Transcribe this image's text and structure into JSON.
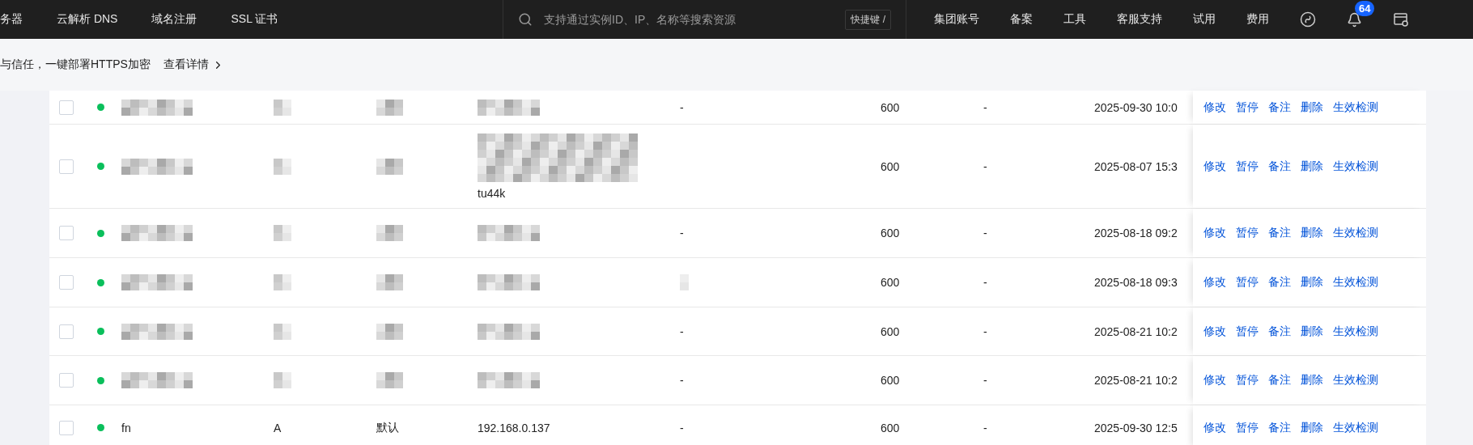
{
  "topbar": {
    "nav_left": [
      "务器",
      "云解析 DNS",
      "域名注册",
      "SSL 证书"
    ],
    "search": {
      "placeholder": "支持通过实例ID、IP、名称等搜索资源",
      "shortcut": "快捷键 /"
    },
    "nav_right": [
      "集团账号",
      "备案",
      "工具",
      "客服支持",
      "试用",
      "费用"
    ],
    "notifications": {
      "count": "64"
    }
  },
  "banner": {
    "text": "与信任，一键部署HTTPS加密",
    "link": "查看详情"
  },
  "records": [
    {
      "checked": false,
      "enabled": true,
      "host": {
        "kind": "redacted"
      },
      "type": {
        "kind": "redacted"
      },
      "line": {
        "kind": "redacted"
      },
      "value": {
        "kind": "redacted"
      },
      "remark": {
        "kind": "text",
        "text": "-"
      },
      "ttl": "600",
      "weight": "-",
      "time": "2025-09-30 10:0",
      "actions": [
        "修改",
        "暂停",
        "备注",
        "删除",
        "生效检测"
      ]
    },
    {
      "checked": false,
      "enabled": true,
      "host": {
        "kind": "redacted"
      },
      "type": {
        "kind": "redacted"
      },
      "line": {
        "kind": "redacted"
      },
      "value": {
        "kind": "redacted_tail",
        "text": "tu44k"
      },
      "ttl": "600",
      "weight": "-",
      "time": "2025-08-07 15:3",
      "actions": [
        "修改",
        "暂停",
        "备注",
        "删除",
        "生效检测"
      ]
    },
    {
      "checked": false,
      "enabled": true,
      "host": {
        "kind": "redacted"
      },
      "type": {
        "kind": "redacted"
      },
      "line": {
        "kind": "redacted"
      },
      "value": {
        "kind": "redacted"
      },
      "remark": {
        "kind": "text",
        "text": "-"
      },
      "ttl": "600",
      "weight": "-",
      "time": "2025-08-18 09:2",
      "actions": [
        "修改",
        "暂停",
        "备注",
        "删除",
        "生效检测"
      ]
    },
    {
      "checked": false,
      "enabled": true,
      "host": {
        "kind": "redacted"
      },
      "type": {
        "kind": "redacted"
      },
      "line": {
        "kind": "redacted"
      },
      "value": {
        "kind": "redacted"
      },
      "remark": {
        "kind": "redacted"
      },
      "ttl": "600",
      "weight": "-",
      "time": "2025-08-18 09:3",
      "actions": [
        "修改",
        "暂停",
        "备注",
        "删除",
        "生效检测"
      ]
    },
    {
      "checked": false,
      "enabled": true,
      "host": {
        "kind": "redacted"
      },
      "type": {
        "kind": "redacted"
      },
      "line": {
        "kind": "redacted"
      },
      "value": {
        "kind": "redacted"
      },
      "remark": {
        "kind": "text",
        "text": "-"
      },
      "ttl": "600",
      "weight": "-",
      "time": "2025-08-21 10:2",
      "actions": [
        "修改",
        "暂停",
        "备注",
        "删除",
        "生效检测"
      ]
    },
    {
      "checked": false,
      "enabled": true,
      "host": {
        "kind": "redacted"
      },
      "type": {
        "kind": "redacted"
      },
      "line": {
        "kind": "redacted"
      },
      "value": {
        "kind": "redacted"
      },
      "remark": {
        "kind": "text",
        "text": "-"
      },
      "ttl": "600",
      "weight": "-",
      "time": "2025-08-21 10:2",
      "actions": [
        "修改",
        "暂停",
        "备注",
        "删除",
        "生效检测"
      ]
    },
    {
      "checked": false,
      "enabled": true,
      "host": {
        "kind": "text",
        "text": "fn"
      },
      "type": {
        "kind": "text",
        "text": "A"
      },
      "line": {
        "kind": "text",
        "text": "默认"
      },
      "value": {
        "kind": "text",
        "text": "192.168.0.137"
      },
      "remark": {
        "kind": "text",
        "text": "-"
      },
      "ttl": "600",
      "weight": "-",
      "time": "2025-09-30 12:5",
      "actions": [
        "修改",
        "暂停",
        "备注",
        "删除",
        "生效检测"
      ]
    }
  ]
}
